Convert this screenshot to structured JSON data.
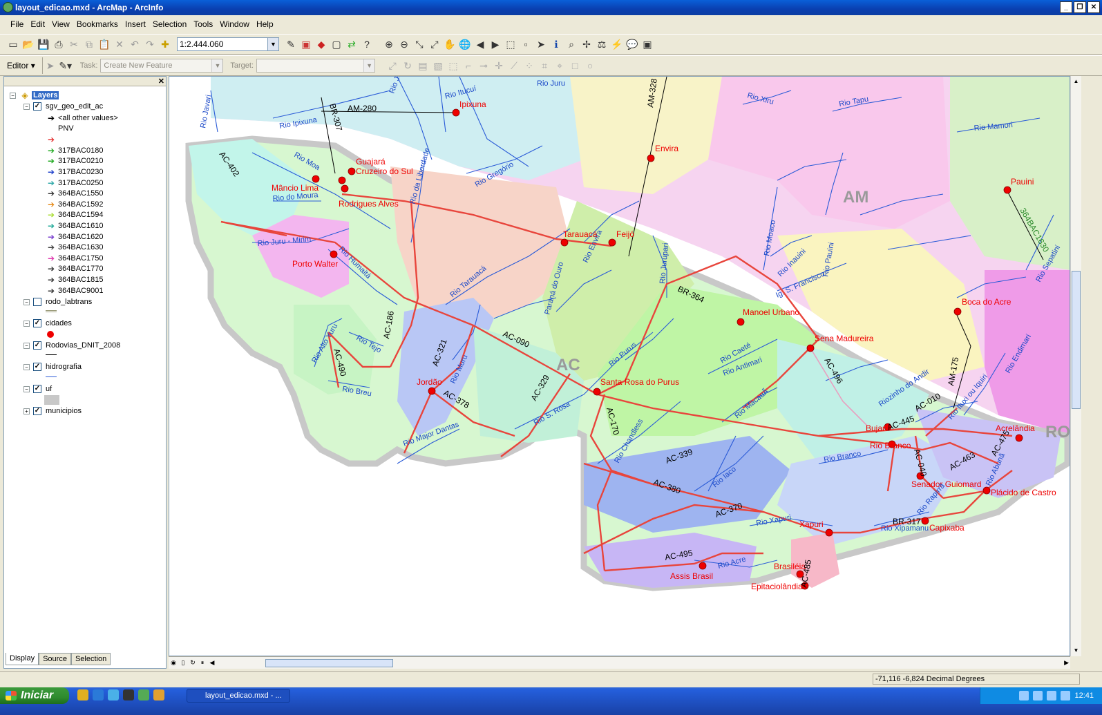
{
  "window": {
    "title": "layout_edicao.mxd - ArcMap - ArcInfo"
  },
  "menu": [
    "File",
    "Edit",
    "View",
    "Bookmarks",
    "Insert",
    "Selection",
    "Tools",
    "Window",
    "Help"
  ],
  "toolbar": {
    "scale_value": "1:2.444.060"
  },
  "editor_toolbar": {
    "editor_label": "Editor",
    "task_label": "Task:",
    "task_value": "Create New Feature",
    "target_label": "Target:",
    "target_value": ""
  },
  "toc": {
    "root": "Layers",
    "layers": [
      {
        "name": "sgv_geo_edit_ac",
        "checked": true
      },
      {
        "name": "rodo_labtrans",
        "checked": false
      },
      {
        "name": "cidades",
        "checked": true
      },
      {
        "name": "Rodovias_DNIT_2008",
        "checked": true
      },
      {
        "name": "hidrografia",
        "checked": true
      },
      {
        "name": "uf",
        "checked": true
      },
      {
        "name": "municipios",
        "checked": true
      }
    ],
    "sgv_items": [
      "<all other values>",
      "PNV",
      "",
      "317BAC0180",
      "317BAC0210",
      "317BAC0230",
      "317BAC0250",
      "364BAC1550",
      "364BAC1592",
      "364BAC1594",
      "364BAC1610",
      "364BAC1620",
      "364BAC1630",
      "364BAC1750",
      "364BAC1770",
      "364BAC1815",
      "364BAC9001"
    ],
    "sgv_colors": [
      "#000000",
      "#000000",
      "#e53333",
      "#22aa22",
      "#22aa22",
      "#2244cc",
      "#33aaaa",
      "#333333",
      "#e58a1a",
      "#aadd33",
      "#22aa99",
      "#7a3fcf",
      "#444444",
      "#e03ab0",
      "#333333",
      "#333333",
      "#333333"
    ],
    "tabs": [
      "Display",
      "Source",
      "Selection"
    ]
  },
  "map": {
    "state_labels": [
      "AM",
      "AC",
      "RO"
    ],
    "cities": [
      "Ipixuna",
      "Guajará",
      "Cruzeiro do Sul",
      "Mâncio Lima",
      "Rodrigues Alves",
      "Envira",
      "Tarauacá",
      "Feijó",
      "Porto Walter",
      "Pauini",
      "Boca do Acre",
      "Manoel Urbano",
      "Sena Madureira",
      "Jordão",
      "Santa Rosa do Purus",
      "Bujari",
      "Rio Branco",
      "Acrelândia",
      "Senador Guiomard",
      "Plácido de Castro",
      "Capixaba",
      "Xapuri",
      "Brasiléia",
      "Epitaciolândia",
      "Assis Brasil"
    ],
    "roads": [
      "AM-280",
      "BR-307",
      "AM-328",
      "AC-402",
      "BR-364",
      "AC-186",
      "AC-321",
      "AC-490",
      "AC-378",
      "AC-090",
      "AC-329",
      "AC-170",
      "AC-339",
      "AC-380",
      "AC-370",
      "AC-495",
      "AC-445",
      "AC-010",
      "AC-040",
      "AC-463",
      "AC-475",
      "BR-317",
      "AM-175",
      "364BAC1630",
      "AC-496",
      "AC-485"
    ],
    "rivers": [
      "Rio Javari",
      "Rio Ipixuna",
      "Rio Juruá",
      "Rio Itucuí",
      "Rio Juru",
      "Rio Moa",
      "Rio do Moura",
      "Rio Juru - Mirim",
      "Rio Humaitá",
      "Rio Gregório",
      "Rio da Liberdade",
      "Rio Tarauacá",
      "Rio Envira",
      "Rio Muru",
      "Rio Alto Yuru",
      "Rio Tejo",
      "Rio Breu",
      "Rio Major Dantas",
      "Rio S. Rosa",
      "Rio Purus",
      "Rio Chandless",
      "Rio Iaco",
      "Rio Xapuri",
      "Rio Acre",
      "Rio Caeté",
      "Rio MacauÃ",
      "Rio Antimari",
      "Rio Branco",
      "Rio Xipamanu",
      "Rio Endimari",
      "Rio Ituxi ou Iquiri",
      "Rio Xiru",
      "Rio Tapu",
      "Rio Mamori",
      "Rio Sepatini",
      "Rio Inauini",
      "Ig. S. Francisco",
      "Rio Moaco",
      "Rio Pauini",
      "Rio Jurupari",
      "Riozinho do Andir",
      "Rio Rapirrã",
      "Rio Abunã",
      "Paraná do Ouro"
    ]
  },
  "status": {
    "coordinates": "-71,116  -6,824 Decimal Degrees"
  },
  "taskbar": {
    "start_label": "Iniciar",
    "task_item": "layout_edicao.mxd - ...",
    "clock": "12:41"
  }
}
